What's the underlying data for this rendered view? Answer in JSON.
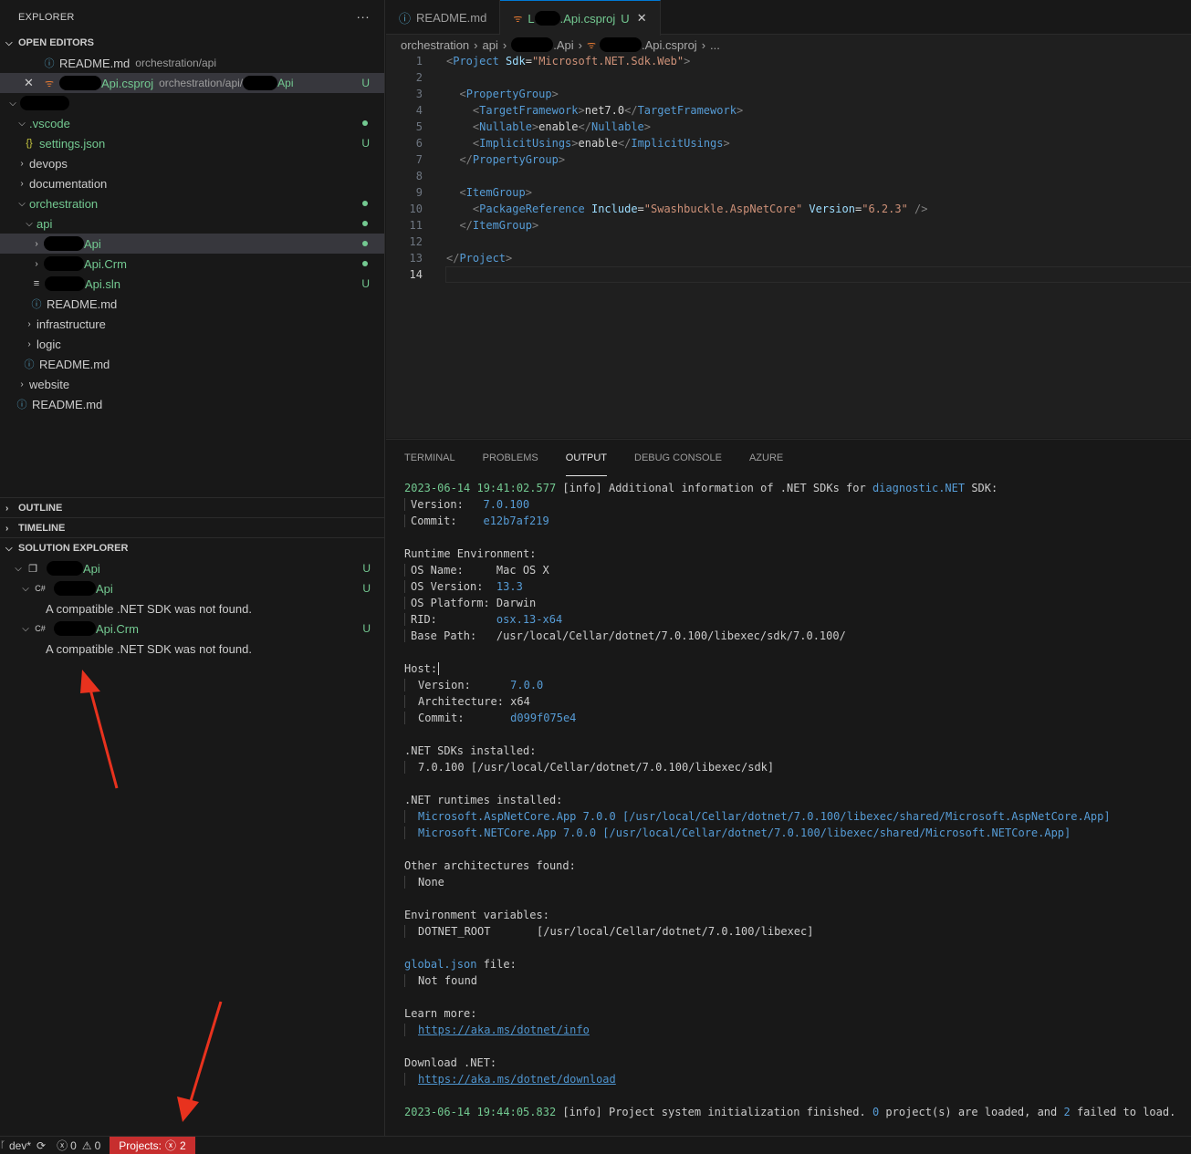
{
  "sidebar": {
    "title": "EXPLORER",
    "more": "···",
    "open_editors": {
      "label": "OPEN EDITORS",
      "items": [
        {
          "name": "README.md",
          "path": "orchestration/api"
        },
        {
          "name": "Api.csproj",
          "path": "orchestration/api/",
          "path_suffix": "Api",
          "badge": "U"
        }
      ]
    },
    "tree": {
      "vscode": ".vscode",
      "settings": "settings.json",
      "settings_badge": "U",
      "devops": "devops",
      "documentation": "documentation",
      "orchestration": "orchestration",
      "api": "api",
      "api_proj": "Api",
      "api_crm": "Api.Crm",
      "api_sln": "Api.sln",
      "api_sln_badge": "U",
      "readme_api": "README.md",
      "infrastructure": "infrastructure",
      "logic": "logic",
      "readme_orch": "README.md",
      "website": "website",
      "readme_root": "README.md"
    },
    "outline": "OUTLINE",
    "timeline": "TIMELINE",
    "solution_explorer": {
      "label": "SOLUTION EXPLORER",
      "solution": "Api",
      "solution_badge": "U",
      "proj1": "Api",
      "proj1_badge": "U",
      "proj1_msg": "A compatible .NET SDK was not found.",
      "proj2": "Api.Crm",
      "proj2_badge": "U",
      "proj2_msg": "A compatible .NET SDK was not found."
    }
  },
  "editor": {
    "tabs": [
      {
        "label": "README.md"
      },
      {
        "label": ".Api.csproj",
        "prefix": "L",
        "badge": "U",
        "close": "✕"
      }
    ],
    "breadcrumb": {
      "p1": "orchestration",
      "p2": "api",
      "p3": ".Api",
      "p4": ".Api.csproj",
      "p5": "..."
    },
    "code": {
      "l1_tag": "Project",
      "l1_attr": "Sdk",
      "l1_val": "\"Microsoft.NET.Sdk.Web\"",
      "l3_tag": "PropertyGroup",
      "l4_tag": "TargetFramework",
      "l4_val": "net7.0",
      "l5_tag": "Nullable",
      "l5_val": "enable",
      "l6_tag": "ImplicitUsings",
      "l6_val": "enable",
      "l7_tag": "PropertyGroup",
      "l9_tag": "ItemGroup",
      "l10_tag": "PackageReference",
      "l10_a1": "Include",
      "l10_v1": "\"Swashbuckle.AspNetCore\"",
      "l10_a2": "Version",
      "l10_v2": "\"6.2.3\"",
      "l11_tag": "ItemGroup",
      "l13_tag": "Project"
    }
  },
  "panel": {
    "tabs": [
      "TERMINAL",
      "PROBLEMS",
      "OUTPUT",
      "DEBUG CONSOLE",
      "AZURE"
    ],
    "output": {
      "first_ts": "2023-06-14 19:41:02.577",
      "first_msg": " [info] Additional information of .NET SDKs for ",
      "first_link": "diagnostic.NET",
      "first_end": " SDK:",
      "version_label": "Version:   ",
      "version_val": "7.0.100",
      "commit_label": "Commit:    ",
      "commit_val": "e12b7af219",
      "runtime_env": "Runtime Environment:",
      "os_name_label": "OS Name:     ",
      "os_name_val": "Mac OS X",
      "os_version_label": "OS Version:  ",
      "os_version_val": "13.3",
      "os_platform_label": "OS Platform: ",
      "os_platform_val": "Darwin",
      "rid_label": "RID:         ",
      "rid_val": "osx.13-x64",
      "base_path_label": "Base Path:   ",
      "base_path_val": "/usr/local/Cellar/dotnet/7.0.100/libexec/sdk/7.0.100/",
      "host": "Host:",
      "host_version_label": "Version:      ",
      "host_version_val": "7.0.0",
      "arch_label": "Architecture: ",
      "arch_val": "x64",
      "host_commit_label": "Commit:       ",
      "host_commit_val": "d099f075e4",
      "sdks_installed": ".NET SDKs installed:",
      "sdk_line": "7.0.100 [/usr/local/Cellar/dotnet/7.0.100/libexec/sdk]",
      "runtimes_installed": ".NET runtimes installed:",
      "rt1": "Microsoft.AspNetCore.App 7.0.0 [/usr/local/Cellar/dotnet/7.0.100/libexec/shared/Microsoft.AspNetCore.App]",
      "rt2": "Microsoft.NETCore.App 7.0.0 [/usr/local/Cellar/dotnet/7.0.100/libexec/shared/Microsoft.NETCore.App]",
      "other_arch": "Other architectures found:",
      "none": "None",
      "env_vars": "Environment variables:",
      "dotnet_root_label": "DOTNET_ROOT       ",
      "dotnet_root_val": "[/usr/local/Cellar/dotnet/7.0.100/libexec]",
      "global_json": "global.json",
      "global_json_rest": " file:",
      "not_found": "Not found",
      "learn_more": "Learn more:",
      "learn_link": "https://aka.ms/dotnet/info",
      "download": "Download .NET:",
      "download_link": "https://aka.ms/dotnet/download",
      "last_ts": "2023-06-14 19:44:05.832",
      "last_msg": " [info] Project system initialization finished. ",
      "last_zero": "0",
      "last_mid": " project(s) are loaded, and ",
      "last_two": "2",
      "last_end": " failed to load."
    }
  },
  "statusbar": {
    "branch": "dev*",
    "errors": "0",
    "warnings": "0",
    "projects_label": "Projects:",
    "projects_count": "2"
  },
  "colors": {
    "accent": "#0078d4",
    "git_untracked": "#73c991",
    "error_bg": "#c72e2e",
    "arrow": "#e8321e"
  }
}
